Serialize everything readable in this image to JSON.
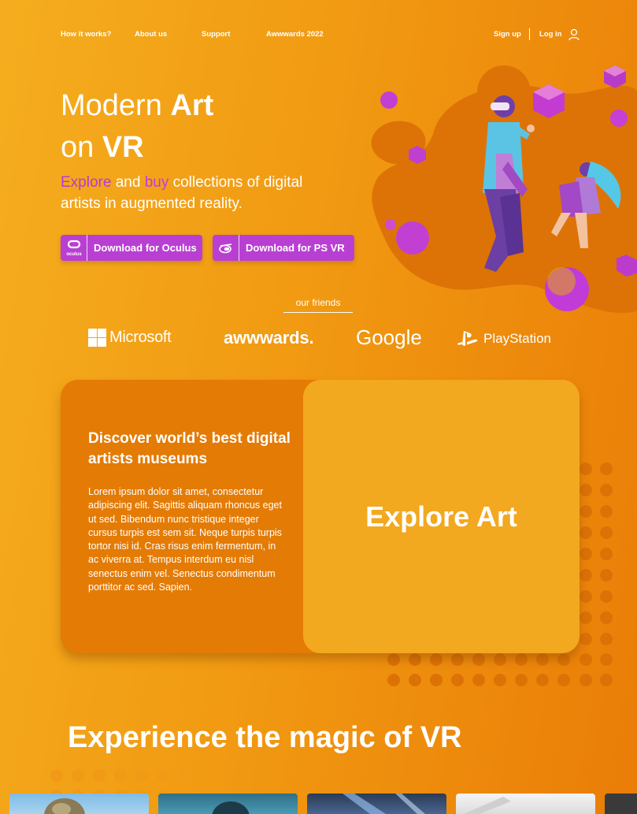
{
  "nav": {
    "links": [
      "How it works?",
      "About us",
      "Support",
      "Awwwards 2022"
    ],
    "sign_up": "Sign up",
    "log_in": "Log in"
  },
  "hero": {
    "title_line1_regular": "Modern ",
    "title_line1_bold": "Art",
    "title_line2_regular": "on ",
    "title_line2_bold": "VR",
    "subtitle_explore": "Explore",
    "subtitle_and": " and ",
    "subtitle_buy": "buy",
    "subtitle_rest": " collections of digital artists in augmented reality.",
    "btn_oculus": "Download for Oculus",
    "btn_oculus_icon_text": "oculus",
    "btn_psvr": "Download for PS VR"
  },
  "friends": {
    "label": "our friends",
    "logos": [
      "Microsoft",
      "awwwards.",
      "Google",
      "PlayStation"
    ]
  },
  "card": {
    "title": "Discover world’s best digital artists museums",
    "body": "Lorem ipsum dolor sit amet, consectetur adipiscing elit. Sagittis aliquam rhoncus eget ut sed. Bibendum nunc tristique integer cursus turpis est sem sit. Neque turpis turpis tortor nisi id. Cras risus enim fermentum, in ac viverra at. Tempus interdum eu nisl senectus enim vel. Senectus condimentum porttitor ac sed. Sapien.",
    "explore_label": "Explore Art"
  },
  "experience": {
    "title": "Experience the magic of VR"
  },
  "colors": {
    "accent_purple": "#b93fd3",
    "card_orange": "#e47b05",
    "card_light": "#f2a81f"
  }
}
